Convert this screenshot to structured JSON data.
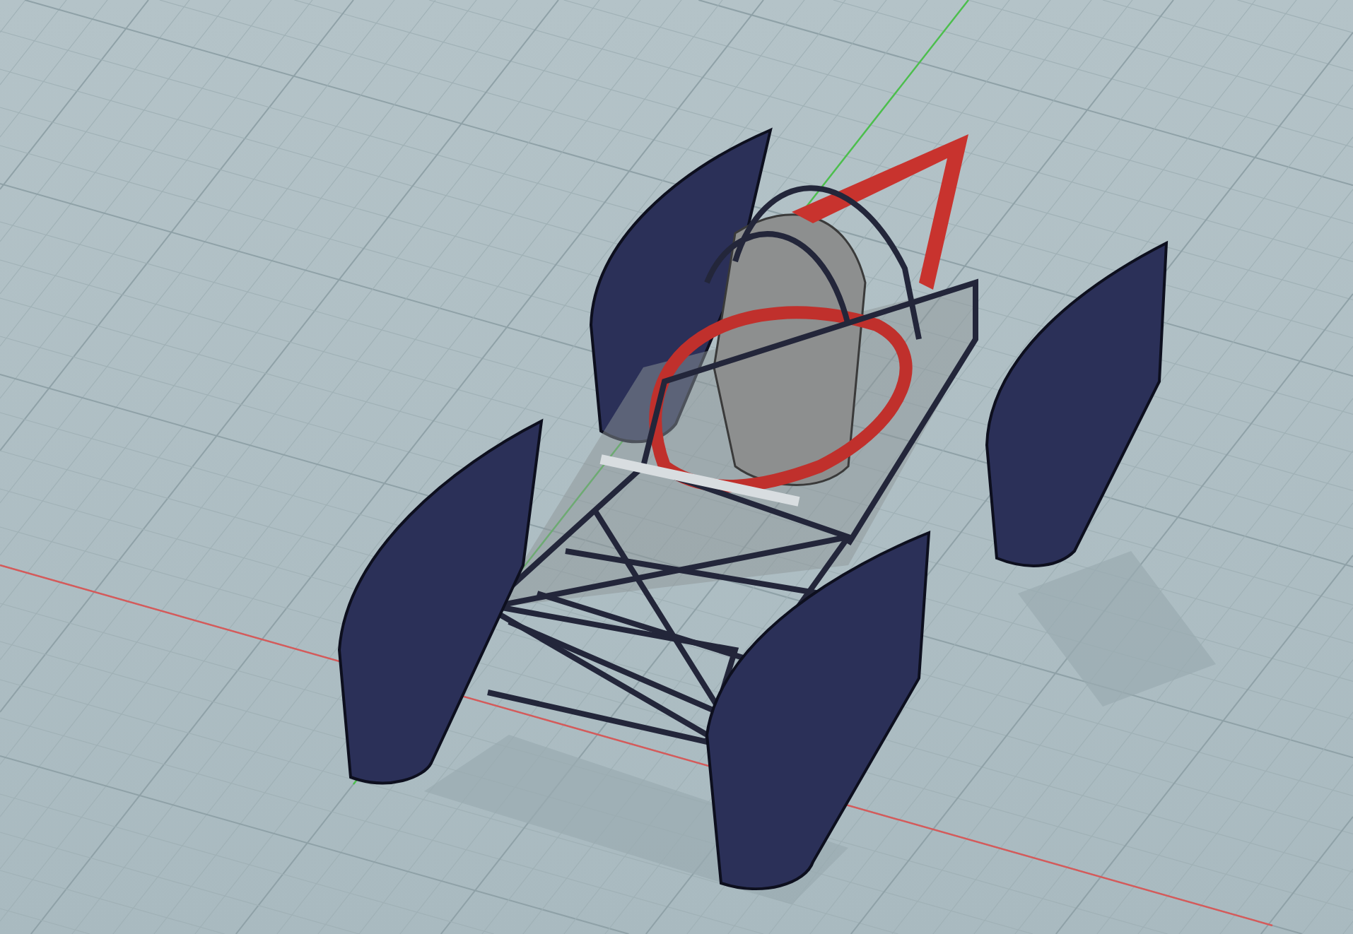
{
  "viewport": {
    "axes": [
      {
        "kind": "x",
        "color": "#d65a5a"
      },
      {
        "kind": "y",
        "color": "#4cc04c"
      }
    ]
  }
}
